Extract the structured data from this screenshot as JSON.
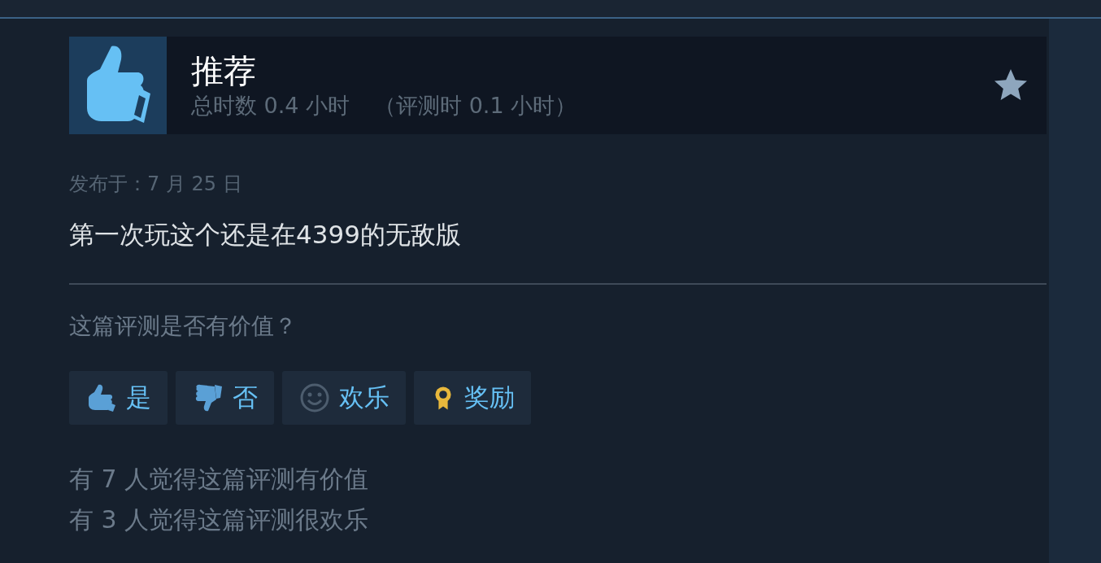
{
  "review": {
    "verdict": "推荐",
    "hours": "总时数 0.4 小时",
    "review_hours": "（评测时 0.1 小时）",
    "posted": "发布于：7 月 25 日",
    "text": "第一次玩这个还是在4399的无敌版"
  },
  "helpful": {
    "question": "这篇评测是否有价值？",
    "buttons": [
      {
        "kind": "thumb-up",
        "label": "是"
      },
      {
        "kind": "thumb-down",
        "label": "否"
      },
      {
        "kind": "smile",
        "label": "欢乐"
      },
      {
        "kind": "award",
        "label": "奖励"
      }
    ],
    "counts": [
      "有 7 人觉得这篇评测有价值",
      "有 3 人觉得这篇评测很欢乐"
    ]
  }
}
